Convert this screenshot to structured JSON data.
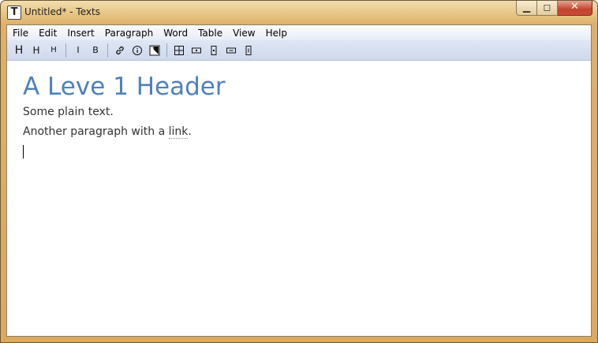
{
  "window": {
    "title": "Untitled* - Texts",
    "app_icon_letter": "T"
  },
  "window_buttons": {
    "minimize": "minimize-icon",
    "maximize": "maximize-icon",
    "close": "close-icon"
  },
  "menu": {
    "items": [
      "File",
      "Edit",
      "Insert",
      "Paragraph",
      "Word",
      "Table",
      "View",
      "Help"
    ]
  },
  "toolbar": {
    "h1": "H",
    "h2": "H",
    "h3": "H",
    "italic": "I",
    "bold": "B",
    "icons": [
      "link-icon",
      "info-icon",
      "image-icon",
      "table-icon",
      "insert-row-icon",
      "insert-column-icon",
      "delete-row-icon",
      "delete-column-icon"
    ]
  },
  "document": {
    "heading": "A Leve 1 Header",
    "paragraph1": "Some plain text.",
    "paragraph2_before": "Another paragraph with a ",
    "paragraph2_link": "link",
    "paragraph2_after": "."
  },
  "colors": {
    "heading": "#4f81bd",
    "frame": "#dcae62",
    "menubar": "#e7ecf6",
    "toolbar": "#d4ddef"
  }
}
